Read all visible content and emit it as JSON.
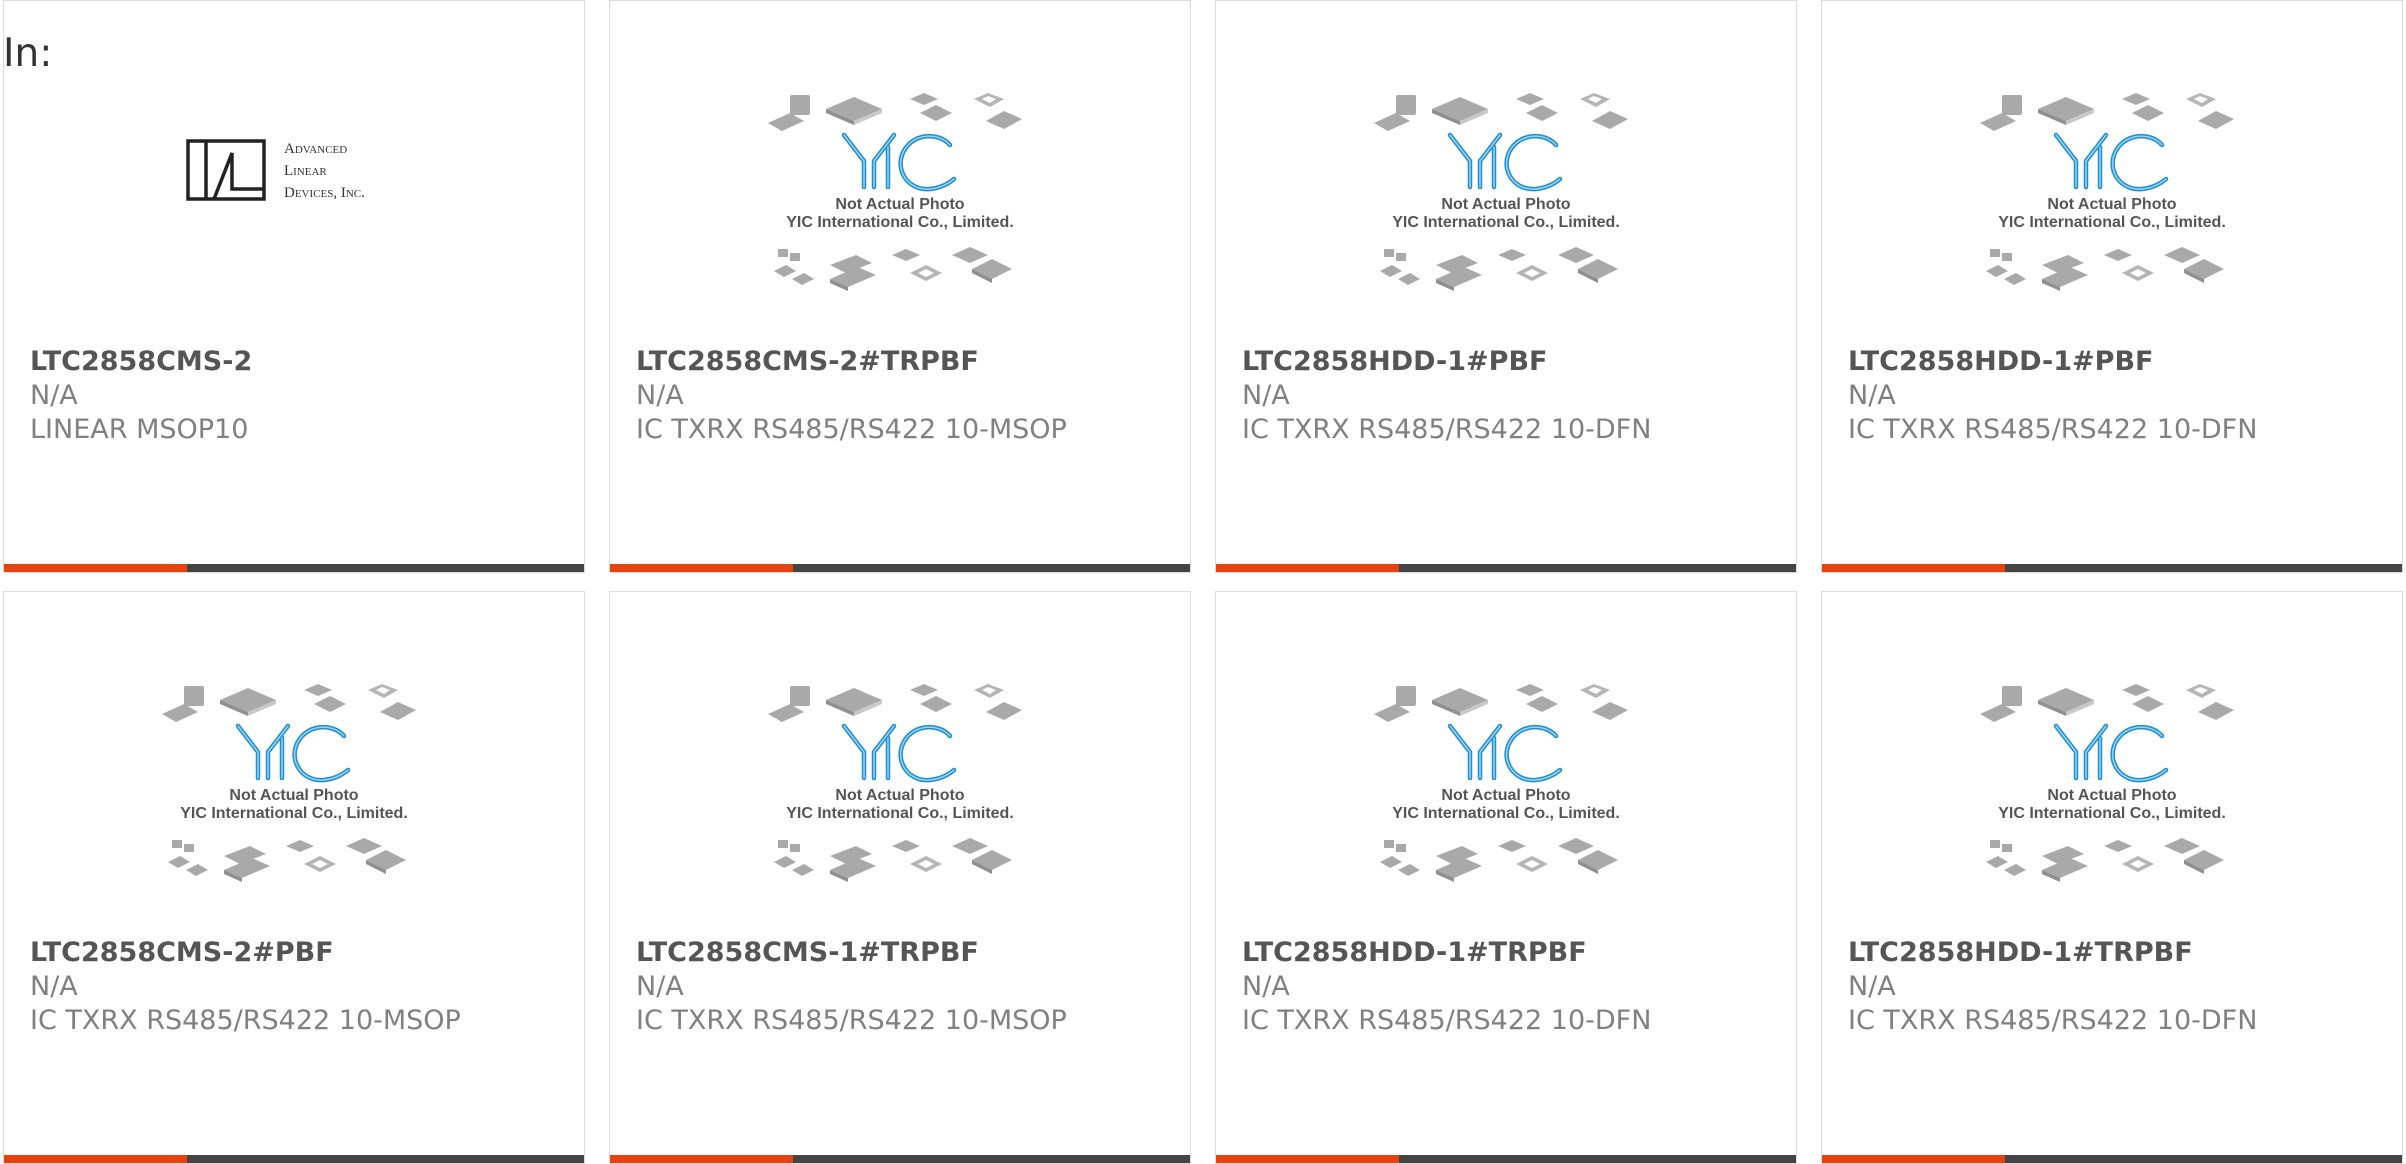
{
  "page": {
    "label": "In:"
  },
  "colors": {
    "accent": "#e8420f",
    "bar": "#444444",
    "part_number": "#555555",
    "secondary_text": "#808080",
    "yic_logo_blue": "#1a8fd1"
  },
  "products": [
    {
      "part_number": "LTC2858CMS-2",
      "availability": "N/A",
      "description": "LINEAR MSOP10",
      "image": {
        "type": "manufacturer-logo",
        "icon": "advanced-linear-devices-logo",
        "lines": [
          "Advanced",
          "Linear",
          "Devices, Inc."
        ]
      }
    },
    {
      "part_number": "LTC2858CMS-2#TRPBF",
      "availability": "N/A",
      "description": "IC TXRX RS485/RS422 10-MSOP",
      "image": {
        "type": "placeholder",
        "icon": "yic-placeholder-image",
        "caption_1": "Not Actual Photo",
        "caption_2": "YIC International Co., Limited."
      }
    },
    {
      "part_number": "LTC2858HDD-1#PBF",
      "availability": "N/A",
      "description": "IC TXRX RS485/RS422 10-DFN",
      "image": {
        "type": "placeholder",
        "icon": "yic-placeholder-image",
        "caption_1": "Not Actual Photo",
        "caption_2": "YIC International Co., Limited."
      }
    },
    {
      "part_number": "LTC2858HDD-1#PBF",
      "availability": "N/A",
      "description": "IC TXRX RS485/RS422 10-DFN",
      "image": {
        "type": "placeholder",
        "icon": "yic-placeholder-image",
        "caption_1": "Not Actual Photo",
        "caption_2": "YIC International Co., Limited."
      }
    },
    {
      "part_number": "LTC2858CMS-2#PBF",
      "availability": "N/A",
      "description": "IC TXRX RS485/RS422 10-MSOP",
      "image": {
        "type": "placeholder",
        "icon": "yic-placeholder-image",
        "caption_1": "Not Actual Photo",
        "caption_2": "YIC International Co., Limited."
      }
    },
    {
      "part_number": "LTC2858CMS-1#TRPBF",
      "availability": "N/A",
      "description": "IC TXRX RS485/RS422 10-MSOP",
      "image": {
        "type": "placeholder",
        "icon": "yic-placeholder-image",
        "caption_1": "Not Actual Photo",
        "caption_2": "YIC International Co., Limited."
      }
    },
    {
      "part_number": "LTC2858HDD-1#TRPBF",
      "availability": "N/A",
      "description": "IC TXRX RS485/RS422 10-DFN",
      "image": {
        "type": "placeholder",
        "icon": "yic-placeholder-image",
        "caption_1": "Not Actual Photo",
        "caption_2": "YIC International Co., Limited."
      }
    },
    {
      "part_number": "LTC2858HDD-1#TRPBF",
      "availability": "N/A",
      "description": "IC TXRX RS485/RS422 10-DFN",
      "image": {
        "type": "placeholder",
        "icon": "yic-placeholder-image",
        "caption_1": "Not Actual Photo",
        "caption_2": "YIC International Co., Limited."
      }
    }
  ]
}
